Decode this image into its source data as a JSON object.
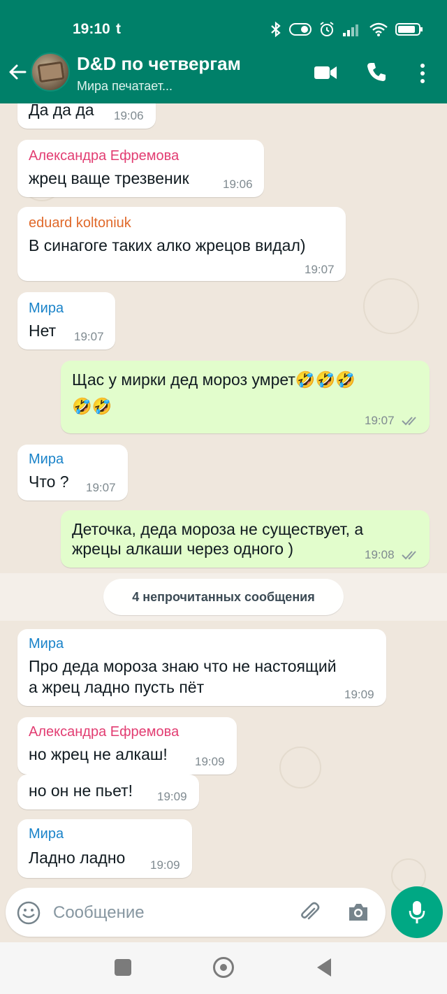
{
  "status_bar": {
    "time": "19:10",
    "carrier_icon": "t",
    "battery": "battery-icon"
  },
  "header": {
    "title": "D&D по четвергам",
    "subtitle": "Мира печатает..."
  },
  "colors": {
    "header_bg": "#008069",
    "outgoing_bubble": "#e2fdcc",
    "incoming_bubble": "#ffffff",
    "sender_alexandra": "#e23d72",
    "sender_eduard": "#e0692a",
    "sender_mira": "#1a83c9",
    "mic_button": "#00a884"
  },
  "messages": [
    {
      "sender": "",
      "text": "Да да да",
      "time": "19:06"
    },
    {
      "sender": "Александра Ефремова",
      "text": "жрец ваще трезвеник",
      "time": "19:06"
    },
    {
      "sender": "eduard koltoniuk",
      "text": "В синагоге таких алко жрецов видал)",
      "time": "19:07"
    },
    {
      "sender": "Мира",
      "text": "Нет",
      "time": "19:07"
    },
    {
      "sender": "",
      "text_line1": "Щас у мирки дед мороз умрет🤣🤣🤣",
      "text_line2": "🤣🤣",
      "time": "19:07",
      "outgoing": true
    },
    {
      "sender": "Мира",
      "text": "Что ?",
      "time": "19:07"
    },
    {
      "sender": "",
      "text_line1": "Деточка, деда мороза не существует, а",
      "text_line2": "жрецы алкаши через одного )",
      "time": "19:08",
      "outgoing": true
    },
    {
      "sender": "Мира",
      "text_line1": "Про деда мороза знаю что не настоящий",
      "text_line2": "а жрец ладно пусть пёт",
      "time": "19:09"
    },
    {
      "sender": "Александра Ефремова",
      "text": "но жрец не алкаш!",
      "time": "19:09"
    },
    {
      "sender": "",
      "text": "но он не пьет!",
      "time": "19:09"
    },
    {
      "sender": "Мира",
      "text": "Ладно ладно",
      "time": "19:09"
    }
  ],
  "unread_divider": "4 непрочитанных сообщения",
  "composer": {
    "placeholder": "Сообщение"
  }
}
